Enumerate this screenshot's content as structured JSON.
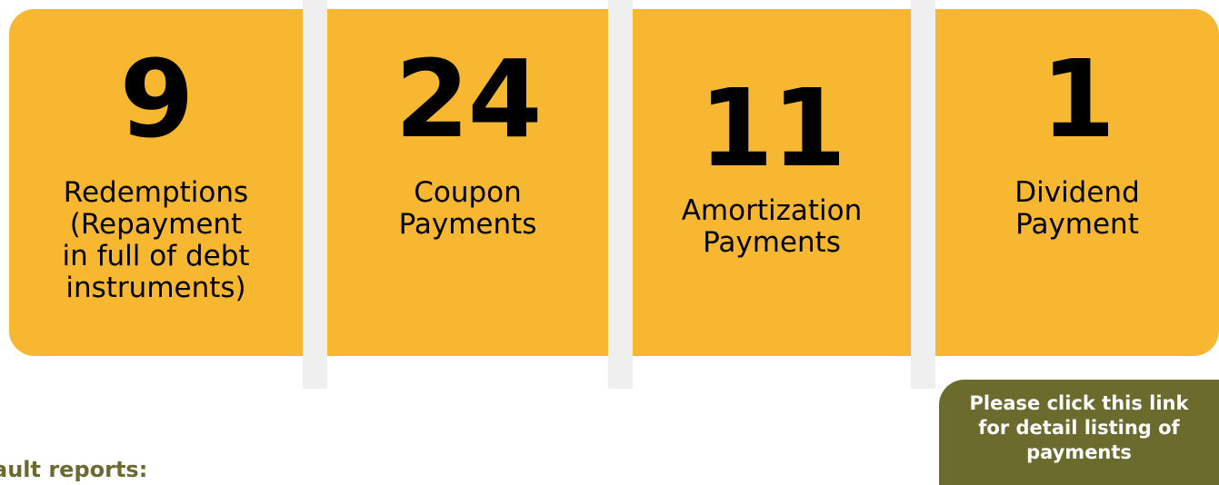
{
  "stats": [
    {
      "number": "9",
      "label": "Redemptions\n(Repayment\nin full of debt\ninstruments)"
    },
    {
      "number": "24",
      "label": "Coupon\nPayments"
    },
    {
      "number": "11",
      "label": "Amortization\nPayments"
    },
    {
      "number": "1",
      "label": "Dividend\nPayment"
    }
  ],
  "link": {
    "label": "Please click this link\nfor detail listing of\npayments"
  },
  "section": {
    "heading": "ault reports:"
  },
  "colors": {
    "card": "#f7b731",
    "link_bg": "#6b6b2e",
    "heading": "#6b6b2e"
  }
}
